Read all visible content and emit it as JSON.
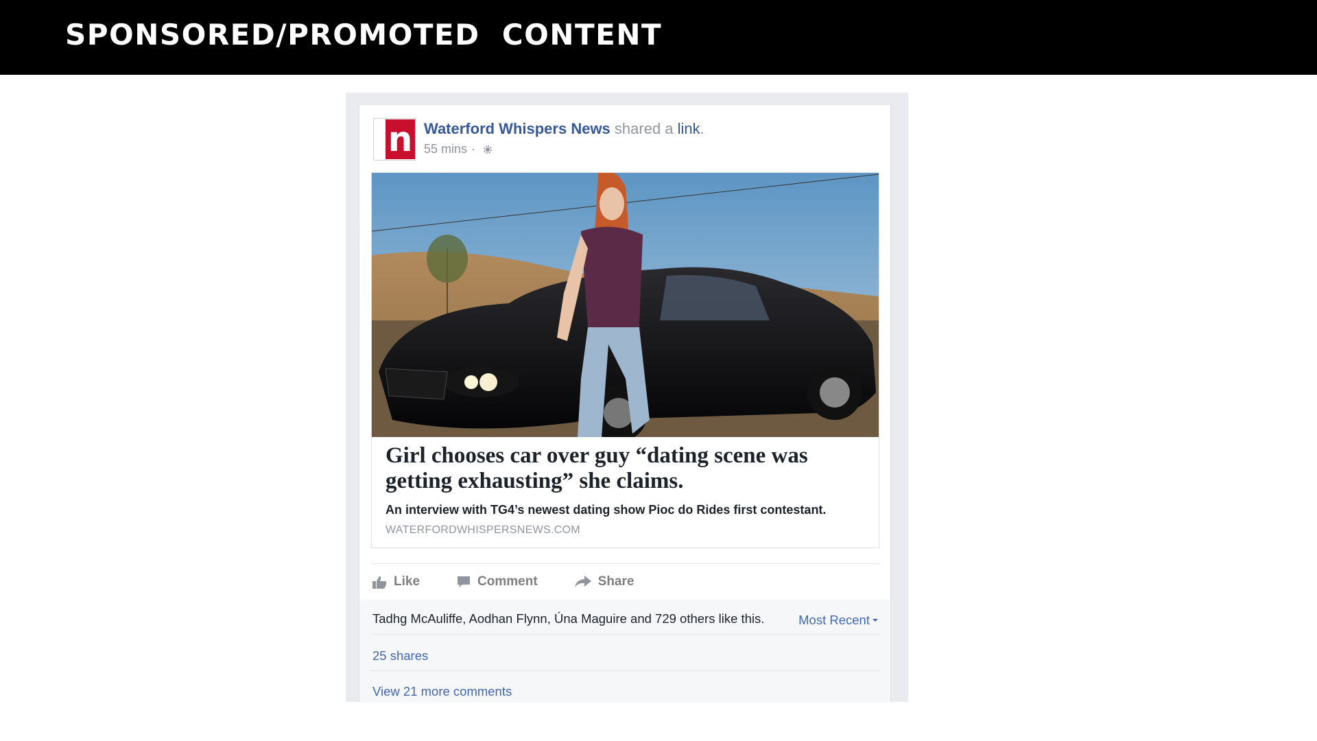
{
  "slide": {
    "title": "SPONSORED/PROMOTED  CONTENT"
  },
  "post": {
    "avatar_letter": "n",
    "page_name": "Waterford Whispers News",
    "shared_text": " shared a ",
    "link_word": "link",
    "period": ".",
    "timestamp": "55 mins",
    "meta_separator": "·",
    "privacy_icon": "globe-icon",
    "link": {
      "image_description_icon": "photo",
      "headline": "Girl chooses car over guy “dating scene was getting exhausting” she claims.",
      "description": "An interview with TG4’s newest dating show Pioc do Rides first contestant.",
      "domain": "WATERFORDWHISPERSNEWS.COM"
    },
    "actions": {
      "like": "Like",
      "comment": "Comment",
      "share": "Share"
    },
    "social": {
      "likes_text": "Tadhg McAuliffe, Aodhan Flynn, Úna Maguire and 729 others like this.",
      "sort_label": "Most Recent",
      "shares_text": "25 shares",
      "more_comments_text": "View 21 more comments"
    }
  },
  "colors": {
    "header_bg": "#000000",
    "facebook_link": "#365899",
    "facebook_blue": "#4267b2",
    "brand_red": "#c8102e",
    "muted_text": "#90949c"
  }
}
